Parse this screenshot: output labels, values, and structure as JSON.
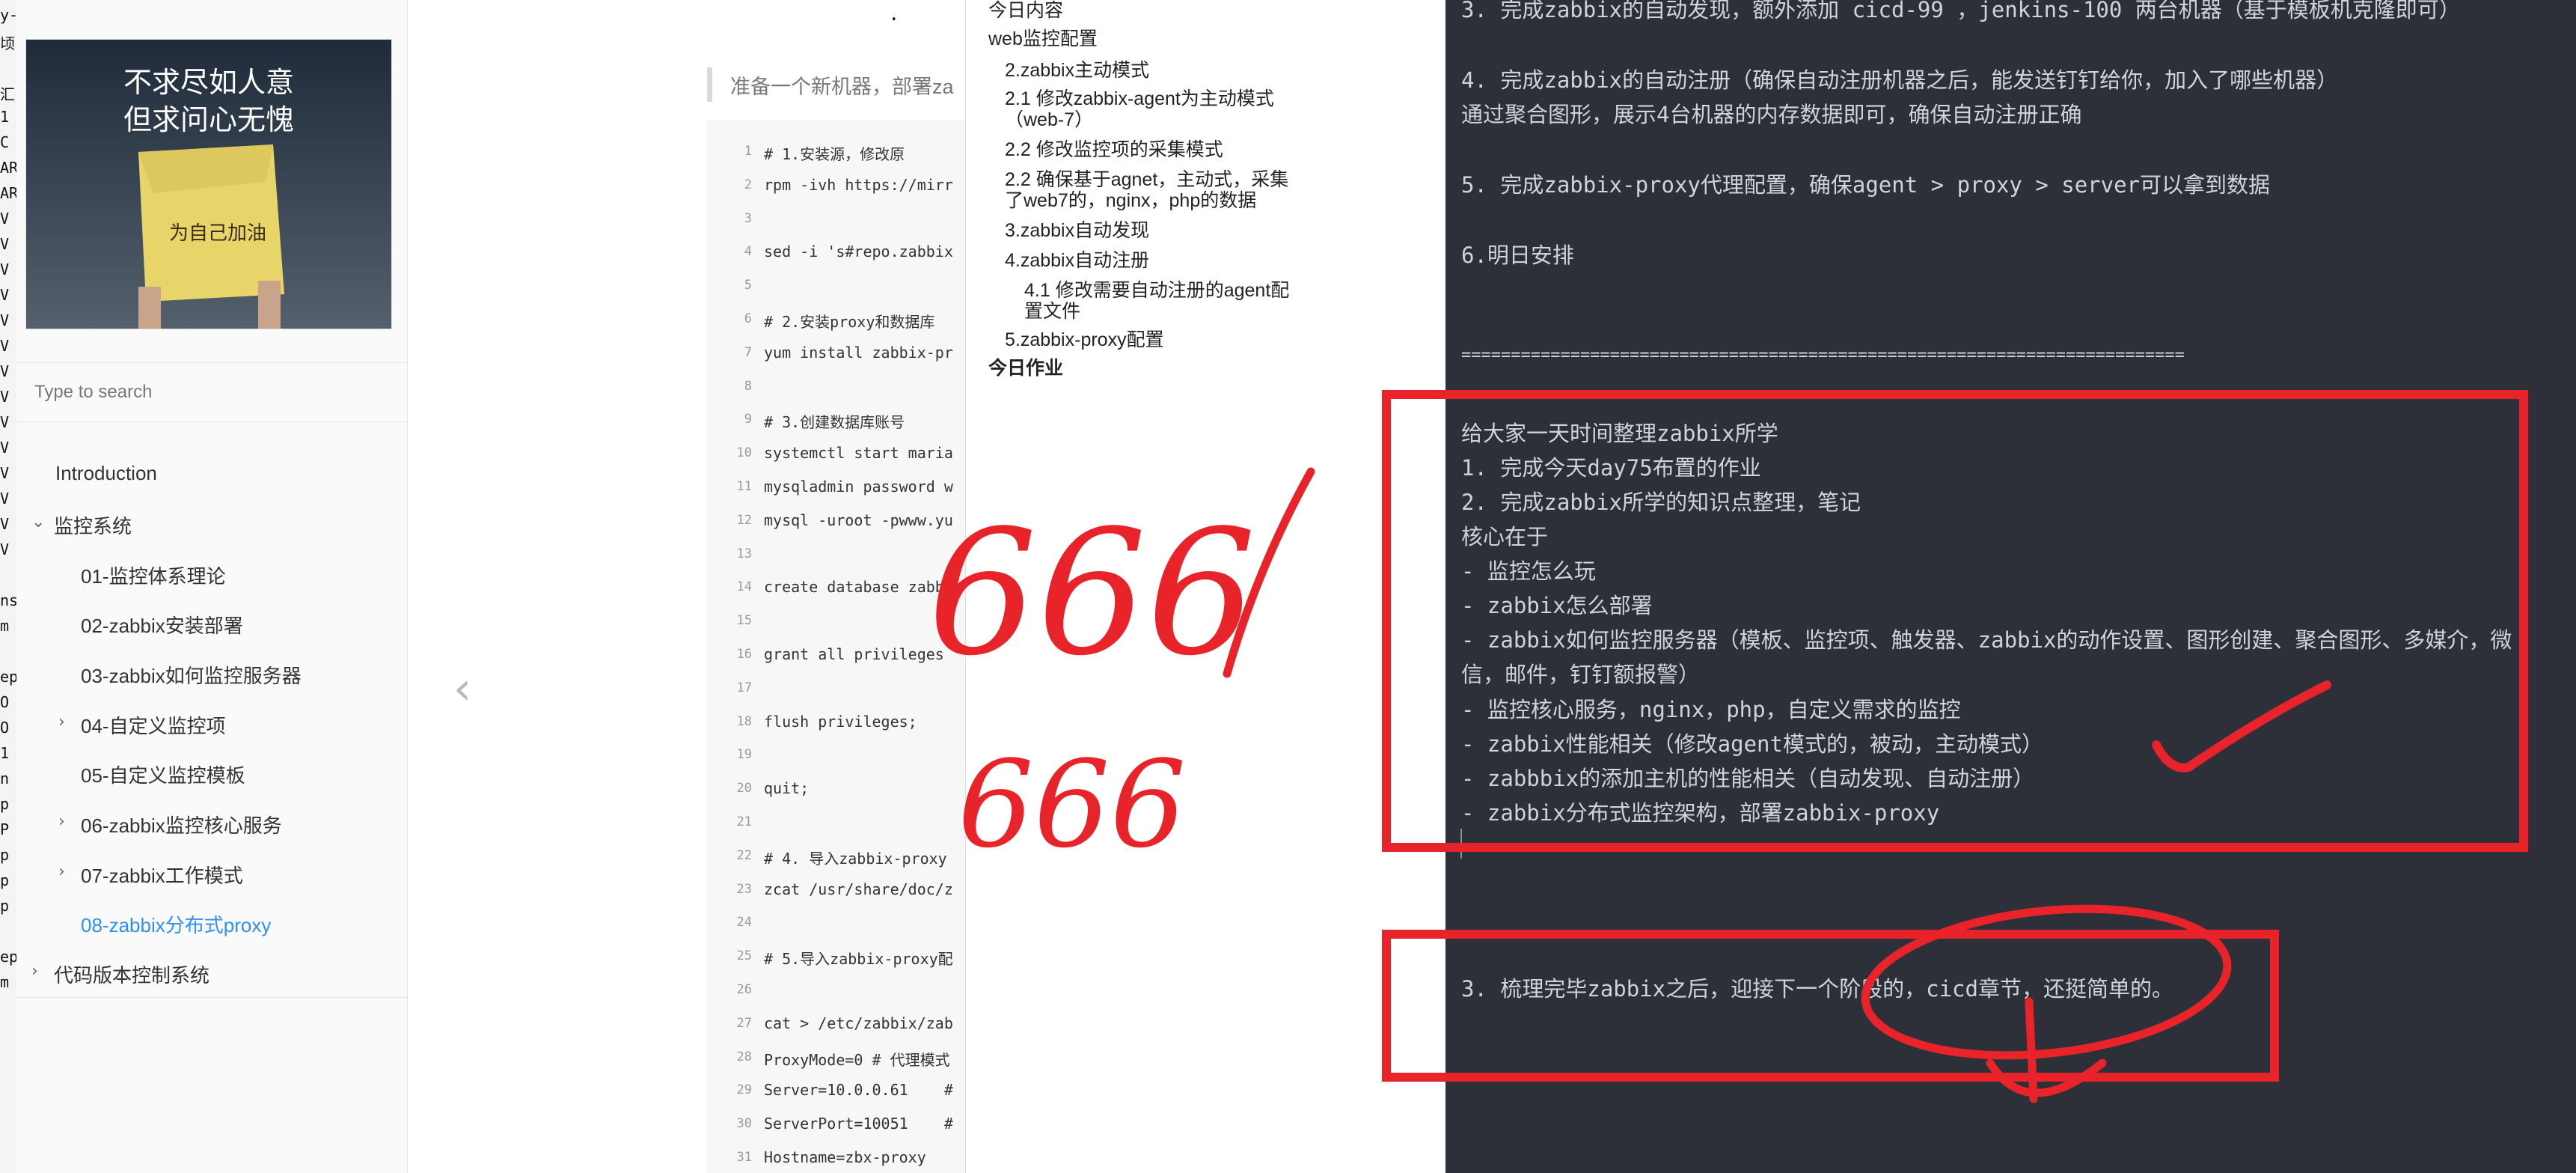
{
  "terminal_strip": {
    "chars": [
      "y-",
      "顷",
      "",
      "汇",
      "1",
      "C",
      "AR",
      "AR",
      "V",
      "V",
      "V",
      "V",
      "V",
      "V",
      "V",
      "V",
      "V",
      "V",
      "V",
      "V",
      "V",
      "V",
      "",
      "ns",
      "m",
      "",
      "ep",
      "O",
      "O",
      "1",
      "n",
      "p",
      "P",
      "p",
      "p",
      "p",
      "",
      "ep",
      "m"
    ]
  },
  "sidebar": {
    "cover": {
      "line1": "不求尽如人意",
      "line2": "但求问心无愧",
      "sign_text": "为自己加油"
    },
    "search_placeholder": "Type to search",
    "items": [
      {
        "label": "Introduction"
      },
      {
        "label": "监控系统",
        "expanded": true
      },
      {
        "label": "01-监控体系理论"
      },
      {
        "label": "02-zabbix安装部署"
      },
      {
        "label": "03-zabbix如何监控服务器"
      },
      {
        "label": "04-自定义监控项"
      },
      {
        "label": "05-自定义监控模板"
      },
      {
        "label": "06-zabbix监控核心服务"
      },
      {
        "label": "07-zabbix工作模式"
      },
      {
        "label": "08-zabbix分布式proxy",
        "active": true
      },
      {
        "label": "代码版本控制系统"
      }
    ]
  },
  "main": {
    "title_fragment": ".",
    "quote": "准备一个新机器，部署za",
    "prev_glyph": "‹",
    "code_lines": [
      {
        "n": "1",
        "t": "# 1.安装源，修改原"
      },
      {
        "n": "2",
        "t": "rpm -ivh https://mirr"
      },
      {
        "n": "3",
        "t": ""
      },
      {
        "n": "4",
        "t": "sed -i 's#repo.zabbix"
      },
      {
        "n": "5",
        "t": ""
      },
      {
        "n": "6",
        "t": "# 2.安装proxy和数据库"
      },
      {
        "n": "7",
        "t": "yum install zabbix-pr"
      },
      {
        "n": "8",
        "t": ""
      },
      {
        "n": "9",
        "t": "# 3.创建数据库账号"
      },
      {
        "n": "10",
        "t": "systemctl start maria"
      },
      {
        "n": "11",
        "t": "mysqladmin password w"
      },
      {
        "n": "12",
        "t": "mysql -uroot -pwww.yu"
      },
      {
        "n": "13",
        "t": ""
      },
      {
        "n": "14",
        "t": "create database zabbi"
      },
      {
        "n": "15",
        "t": ""
      },
      {
        "n": "16",
        "t": "grant all privileges"
      },
      {
        "n": "17",
        "t": ""
      },
      {
        "n": "18",
        "t": "flush privileges;"
      },
      {
        "n": "19",
        "t": ""
      },
      {
        "n": "20",
        "t": "quit;"
      },
      {
        "n": "21",
        "t": ""
      },
      {
        "n": "22",
        "t": "# 4. 导入zabbix-proxy"
      },
      {
        "n": "23",
        "t": "zcat /usr/share/doc/z"
      },
      {
        "n": "24",
        "t": ""
      },
      {
        "n": "25",
        "t": "# 5.导入zabbix-proxy配"
      },
      {
        "n": "26",
        "t": ""
      },
      {
        "n": "27",
        "t": "cat > /etc/zabbix/zab"
      },
      {
        "n": "28",
        "t": "ProxyMode=0 # 代理模式"
      },
      {
        "n": "29",
        "t": "Server=10.0.0.61    #"
      },
      {
        "n": "30",
        "t": "ServerPort=10051    #"
      },
      {
        "n": "31",
        "t": "Hostname=zbx-proxy"
      }
    ]
  },
  "toc": {
    "items": [
      {
        "label": "今日内容",
        "level": 0
      },
      {
        "label": "web监控配置",
        "level": 0
      },
      {
        "label": "2.zabbix主动模式",
        "level": 1
      },
      {
        "label": "2.1 修改zabbix-agent为主动模式",
        "level": 1
      },
      {
        "label": "（web-7）",
        "level": 1
      },
      {
        "label": "2.2 修改监控项的采集模式",
        "level": 1
      },
      {
        "label": "2.2 确保基于agnet，主动式，采集",
        "level": 1
      },
      {
        "label": "了web7的，nginx，php的数据",
        "level": 1
      },
      {
        "label": "3.zabbix自动发现",
        "level": 1
      },
      {
        "label": "4.zabbix自动注册",
        "level": 1
      },
      {
        "label": "4.1 修改需要自动注册的agent配",
        "level": 2
      },
      {
        "label": "置文件",
        "level": 2
      },
      {
        "label": "5.zabbix-proxy配置",
        "level": 1
      },
      {
        "label": "今日作业",
        "level": 0,
        "bold": true
      }
    ]
  },
  "editor": {
    "lines": [
      "3. 完成zabbix的自动发现，额外添加 cicd-99 ，jenkins-100 两台机器（基于模板机克隆即可）",
      "4. 完成zabbix的自动注册（确保自动注册机器之后，能发送钉钉给你，加入了哪些机器）",
      "通过聚合图形，展示4台机器的内存数据即可，确保自动注册正确",
      "5. 完成zabbix-proxy代理配置，确保agent > proxy > server可以拿到数据",
      "6.明日安排",
      "=========================================================================",
      "给大家一天时间整理zabbix所学",
      "1. 完成今天day75布置的作业",
      "2. 完成zabbix所学的知识点整理，笔记",
      "核心在于",
      "- 监控怎么玩",
      "- zabbix怎么部署",
      "- zabbix如何监控服务器（模板、监控项、触发器、zabbix的动作设置、图形创建、聚合图形、多媒介，微",
      "信，邮件，钉钉额报警）",
      "- 监控核心服务，nginx，php，自定义需求的监控",
      "- zabbix性能相关（修改agent模式的，被动，主动模式）",
      "- zabbbix的添加主机的性能相关（自动发现、自动注册）",
      "- zabbix分布式监控架构，部署zabbix-proxy",
      "3. 梳理完毕zabbix之后，迎接下一个阶段的，cicd章节，还挺简单的。"
    ]
  },
  "annotations": {
    "text1": "666",
    "text2": "666",
    "color": "#e8242a"
  },
  "colors": {
    "editor_bg": "#2d3039",
    "active_link": "#2f8ff5",
    "annotation_red": "#e8242a"
  }
}
